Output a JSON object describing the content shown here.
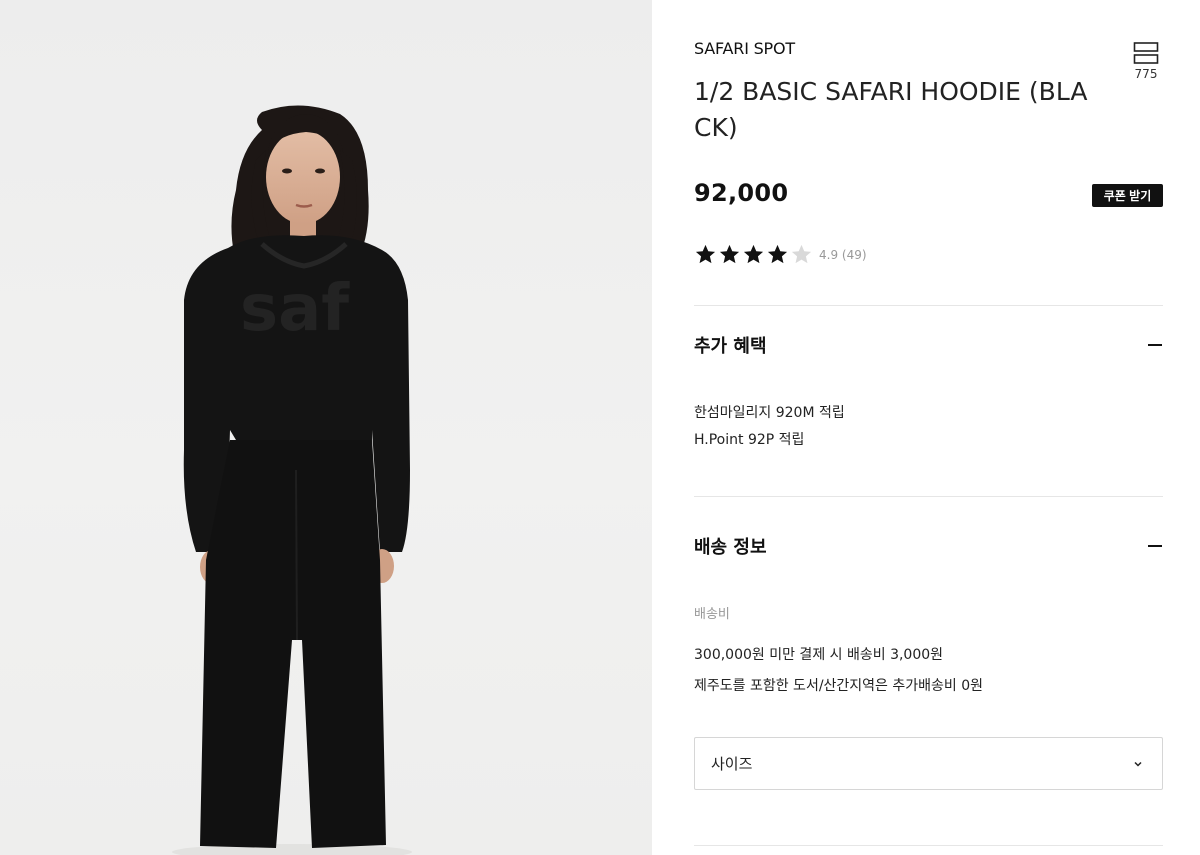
{
  "product": {
    "brand": "SAFARI SPOT",
    "title": "1/2 BASIC SAFARI HOODIE (BLACK)",
    "price": "92,000",
    "coupon_label": "쿠폰 받기",
    "wish_count": "775",
    "wish_icon": "list-icon",
    "print_text": "saf",
    "rating": {
      "stars": 4,
      "max_stars": 5,
      "text": "4.9 (49)"
    }
  },
  "benefits": {
    "title": "추가 혜택",
    "items": [
      "한섬마일리지 920M 적립",
      "H.Point 92P 적립"
    ]
  },
  "shipping": {
    "title": "배송 정보",
    "fee_label": "배송비",
    "lines": [
      "300,000원 미만 결제 시 배송비 3,000원",
      "제주도를 포함한 도서/산간지역은 추가배송비 0원"
    ]
  },
  "size_select": {
    "label": "사이즈"
  },
  "colors": {
    "accent": "#111111",
    "muted": "#999999",
    "border": "#d6d6d6"
  }
}
